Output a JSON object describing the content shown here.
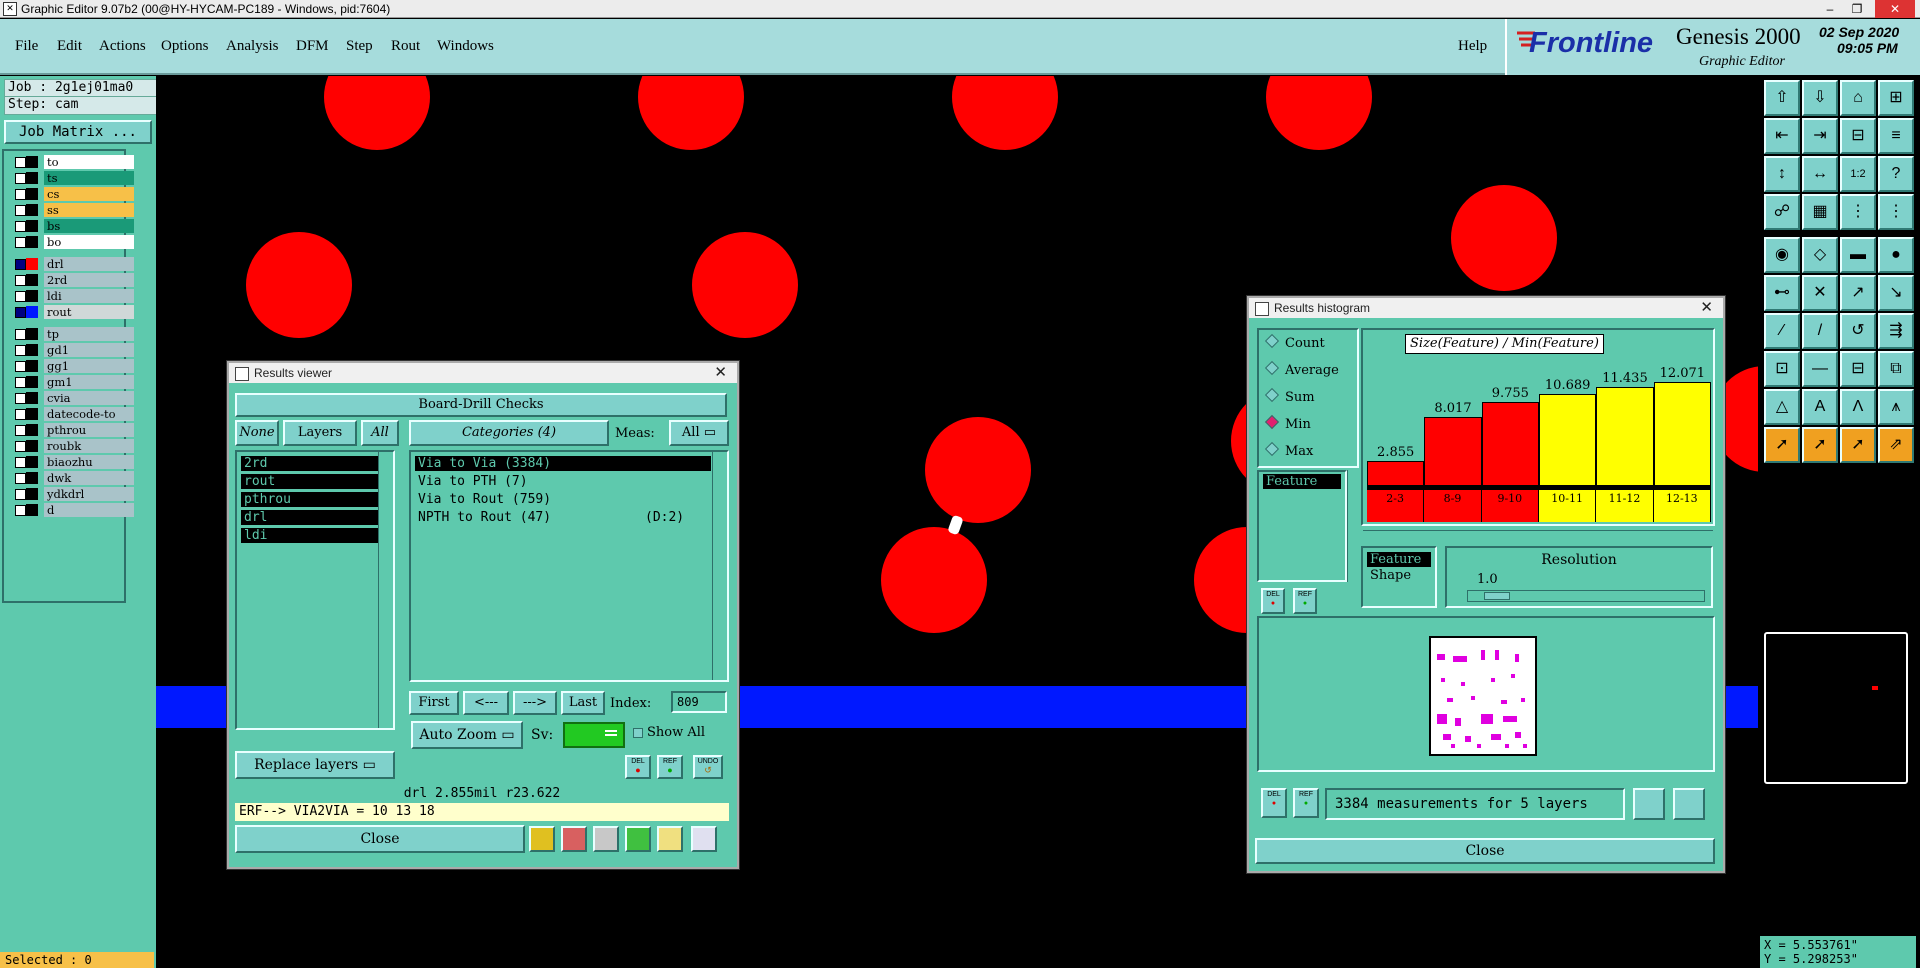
{
  "window": {
    "title": "Graphic Editor 9.07b2 (00@HY-HYCAM-PC189 - Windows, pid:7604)"
  },
  "menu": [
    "File",
    "Edit",
    "Actions",
    "Options",
    "Analysis",
    "DFM",
    "Step",
    "Rout",
    "Windows"
  ],
  "help_label": "Help",
  "brand": {
    "logo": "Frontline",
    "product": "Genesis 2000",
    "subtitle": "Graphic Editor",
    "date": "02 Sep 2020",
    "time": "09:05 PM"
  },
  "left_panel": {
    "job": "Job : 2g1ej01ma0",
    "step": "Step: cam",
    "job_matrix": "Job Matrix ...",
    "selected": "Selected : 0",
    "groups": [
      [
        {
          "name": "to",
          "color": "#ffffff"
        },
        {
          "name": "ts",
          "color": "#1a9a78"
        },
        {
          "name": "cs",
          "color": "#f7c048"
        },
        {
          "name": "ss",
          "color": "#f7c048"
        },
        {
          "name": "bs",
          "color": "#1a9a78"
        },
        {
          "name": "bo",
          "color": "#ffffff"
        }
      ],
      [
        {
          "name": "drl",
          "color": "#a9c3c9",
          "swatch": "#ff0000"
        },
        {
          "name": "2rd",
          "color": "#a9c3c9"
        },
        {
          "name": "ldi",
          "color": "#a9c3c9"
        },
        {
          "name": "rout",
          "color": "#d0d8d8",
          "swatch": "#0018ff"
        }
      ],
      [
        {
          "name": "tp",
          "color": "#a9c3c9"
        },
        {
          "name": "gd1",
          "color": "#a9c3c9"
        },
        {
          "name": "gg1",
          "color": "#a9c3c9"
        },
        {
          "name": "gm1",
          "color": "#a9c3c9"
        },
        {
          "name": "cvia",
          "color": "#a9c3c9"
        },
        {
          "name": "datecode-to",
          "color": "#a9c3c9"
        },
        {
          "name": "pthrou",
          "color": "#a9c3c9"
        },
        {
          "name": "roubk",
          "color": "#a9c3c9"
        },
        {
          "name": "biaozhu",
          "color": "#a9c3c9"
        },
        {
          "name": "dwk",
          "color": "#a9c3c9"
        },
        {
          "name": "ydkdrl",
          "color": "#a9c3c9"
        },
        {
          "name": "d",
          "color": "#a9c3c9"
        }
      ]
    ]
  },
  "results_viewer": {
    "title": "Results viewer",
    "header": "Board-Drill Checks",
    "none_label": "None",
    "layers_label": "Layers",
    "all_label": "All",
    "categories_label": "Categories (4)",
    "meas_label": "Meas:",
    "meas_value": "All",
    "layers": [
      "2rd",
      "rout",
      "pthrou",
      "drl",
      "ldi"
    ],
    "categories": [
      {
        "label": "Via to Via  (3384)",
        "extra": ""
      },
      {
        "label": "Via to PTH  (7)",
        "extra": ""
      },
      {
        "label": "Via to Rout  (759)",
        "extra": ""
      },
      {
        "label": "NPTH to Rout  (47)",
        "extra": "(D:2)"
      }
    ],
    "first": "First",
    "prev": "<---",
    "next": "--->",
    "last": "Last",
    "index_label": "Index:",
    "index_value": "809",
    "auto_zoom": "Auto Zoom",
    "sv_label": "Sv:",
    "show_all": "Show All",
    "replace_layers": "Replace layers",
    "del": "DEL",
    "ref": "REF",
    "undo": "UNDO",
    "status": "drl 2.855mil  r23.622",
    "erf_line": "ERF--> VIA2VIA = 10 13 18",
    "close": "Close"
  },
  "histogram": {
    "title": "Results histogram",
    "chart_title": "Size(Feature) / Min(Feature)",
    "modes": [
      "Count",
      "Average",
      "Sum",
      "Min",
      "Max"
    ],
    "selected_mode": "Min",
    "feature_label": "Feature",
    "feature_opt": "Feature",
    "shape_opt": "Shape",
    "resolution_label": "Resolution",
    "resolution_value": "1.0",
    "measurements": "3384 measurements for 5 layers",
    "close": "Close",
    "del": "DEL",
    "ref": "REF"
  },
  "chart_data": {
    "type": "bar",
    "title": "Size(Feature) / Min(Feature)",
    "categories": [
      "2-3",
      "8-9",
      "9-10",
      "10-11",
      "11-12",
      "12-13"
    ],
    "values": [
      2.855,
      8.017,
      9.755,
      10.689,
      11.435,
      12.071
    ],
    "colors": [
      "#ff0000",
      "#ff0000",
      "#ff0000",
      "#ffff00",
      "#ffff00",
      "#ffff00"
    ],
    "ylim": [
      0,
      12.071
    ]
  },
  "coords": {
    "x": "X = 5.553761\"",
    "y": "Y = 5.298253\""
  }
}
